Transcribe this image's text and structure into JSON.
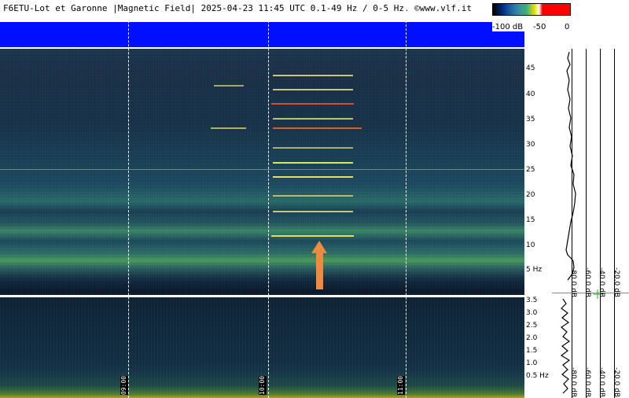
{
  "header": {
    "title": "F6ETU-Lot et Garonne |Magnetic Field| 2025-04-23 11:45 UTC 0.1-49 Hz / 0-5 Hz. ©www.vlf.it"
  },
  "colorbar": {
    "labels": [
      "-100 dB",
      "-50",
      "0"
    ]
  },
  "freq_axis_top": {
    "ticks": [
      "45",
      "40",
      "35",
      "30",
      "25",
      "20",
      "15",
      "10",
      "5 Hz"
    ]
  },
  "freq_axis_bottom": {
    "ticks": [
      "3.5",
      "3.0",
      "2.5",
      "2.0",
      "1.5",
      "1.0",
      "0.5 Hz"
    ]
  },
  "level_scale": {
    "labels": [
      "-80.0 dB",
      "-60.0 dB",
      "-40.0 dB",
      "-20.0 dB"
    ]
  },
  "time_markers": [
    "09:00",
    "10:00",
    "11:00"
  ],
  "colors": {
    "band": "#0010ff",
    "arrow": "#f08a40",
    "tone_line_yellow": "#e6e060",
    "tone_line_red": "#e04020"
  }
}
